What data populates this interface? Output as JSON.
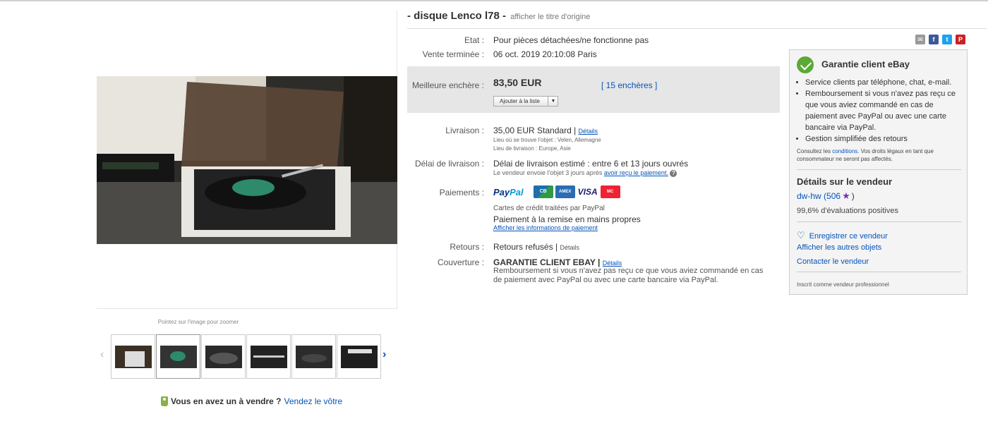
{
  "title": {
    "text": "- disque Lenco l78 -",
    "original_link": "afficher le titre d'origine"
  },
  "image_viewer": {
    "zoom_hint": "Pointez sur l'image pour zoomer",
    "thumbnail_count": 6,
    "selected_thumbnail": 2
  },
  "sell_cta": {
    "question": "Vous en avez un à vendre ?",
    "link": "Vendez le vôtre"
  },
  "details": {
    "condition_label": "Etat :",
    "condition_value": "Pour pièces détachées/ne fonctionne pas",
    "ended_label": "Vente terminée :",
    "ended_value": "06 oct. 2019  20:10:08 Paris",
    "best_bid_label": "Meilleure enchère :",
    "best_bid_value": "83,50 EUR",
    "bids_count": "[ 15 enchères ]",
    "add_to_list": "Ajouter à la liste",
    "shipping_label": "Livraison :",
    "shipping_value": "35,00 EUR  Standard |",
    "shipping_details_link": "Détails",
    "item_location": "Lieu où se trouve l'objet :  Velen, Allemagne",
    "ship_to": "Lieu de livraison :  Europe, Asie",
    "delivery_label": "Délai de livraison :",
    "delivery_value": "Délai de livraison estimé : entre 6 et 13 jours ouvrés",
    "delivery_note_prefix": "Le vendeur envoie l'objet 3 jours après",
    "delivery_note_link": "avoir reçu le paiement.",
    "payments_label": "Paiements :",
    "payment_logos": [
      "PayPal",
      "CB",
      "American Express",
      "VISA",
      "MasterCard"
    ],
    "payment_note1": "Cartes de crédit traitées par PayPal",
    "payment_note2": "Paiement à la remise en mains propres",
    "payment_info_link": "Afficher les informations de paiement",
    "returns_label": "Retours :",
    "returns_value": "Retours refusés |",
    "returns_details_link": "Détails",
    "coverage_label": "Couverture :",
    "coverage_title": "GARANTIE CLIENT EBAY |",
    "coverage_details_link": "Détails",
    "coverage_text1": "Remboursement si vous n'avez pas reçu ce que vous aviez commandé en cas",
    "coverage_text2": "de paiement avec PayPal ou avec une carte bancaire via PayPal."
  },
  "share_icons": [
    "email-icon",
    "facebook-icon",
    "twitter-icon",
    "pinterest-icon"
  ],
  "sidebar": {
    "guarantee_title": "Garantie client eBay",
    "bullets": [
      "Service clients par téléphone, chat, e-mail.",
      "Remboursement si vous n'avez pas reçu ce que vous aviez commandé en cas de paiement avec PayPal ou avec une carte bancaire via PayPal.",
      "Gestion simplifiée des retours"
    ],
    "legal_prefix": "Consultez les",
    "legal_link": "conditions.",
    "legal_suffix": "Vos droits légaux en tant que consommateur ne seront pas affectés.",
    "seller_title": "Détails sur le vendeur",
    "seller_name": "dw-hw",
    "seller_score_prefix": "(506",
    "seller_score_suffix": ")",
    "feedback": "99,6% d'évaluations positives",
    "save_seller": "Enregistrer ce vendeur",
    "other_items": "Afficher les autres objets",
    "contact": "Contacter le vendeur",
    "pro": "Inscrit comme vendeur professionnel"
  },
  "colors": {
    "link": "#0654ba",
    "bid_box": "#e6e6e6",
    "sidebar_bg": "#f4f4f4",
    "guarantee_green": "#5ba936"
  }
}
